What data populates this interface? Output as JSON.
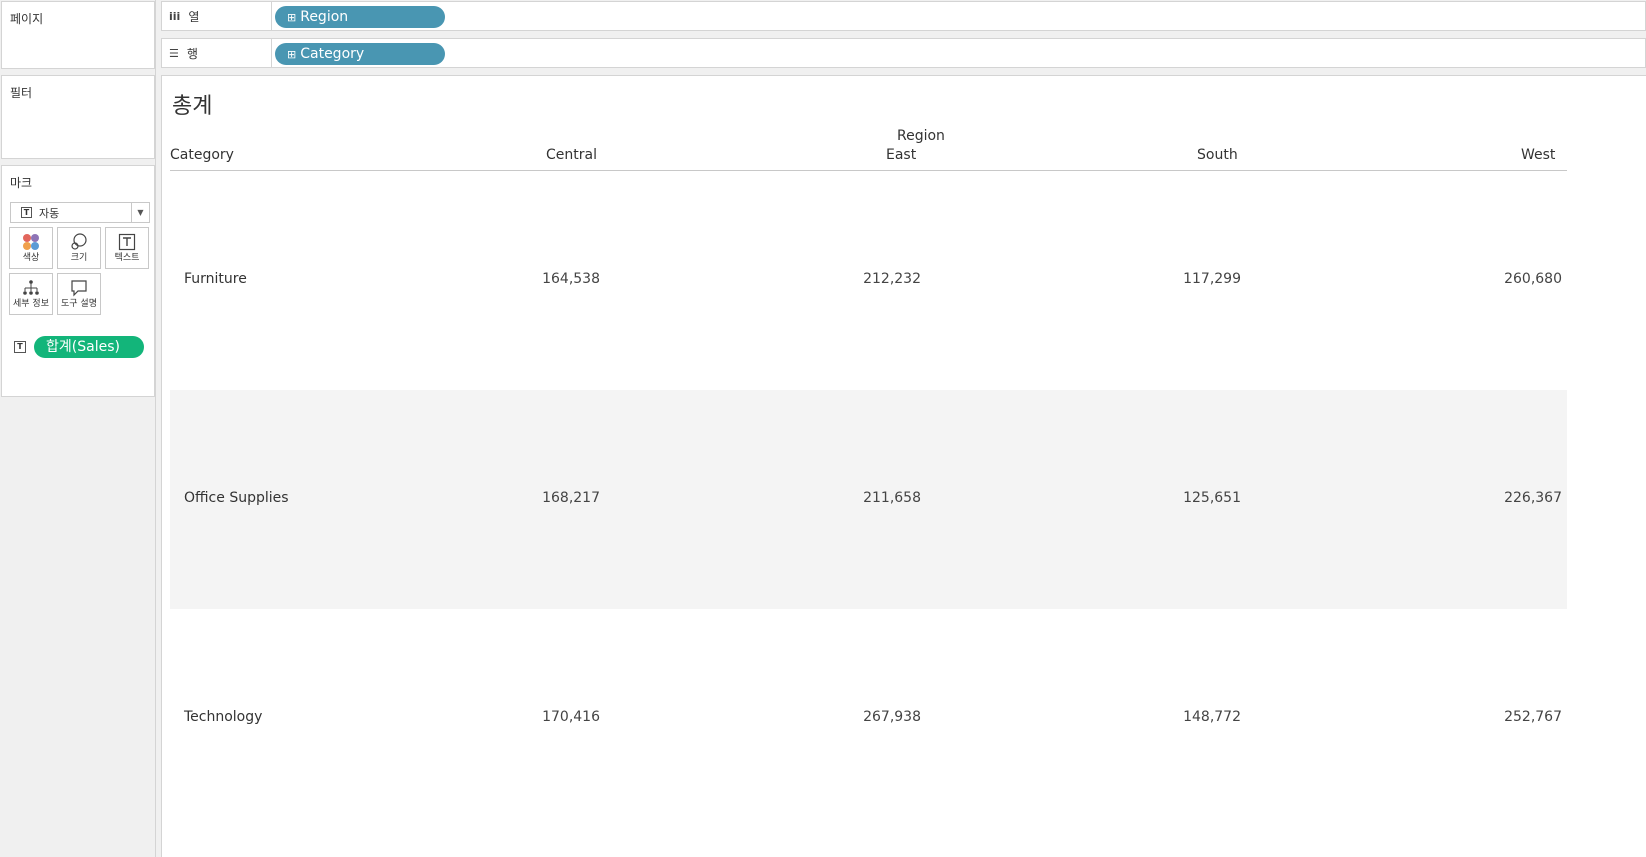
{
  "side": {
    "pages_title": "페이지",
    "filters_title": "필터",
    "marks_title": "마크",
    "mark_type": {
      "icon_glyph": "T",
      "label": "자동",
      "dropdown_glyph": "▼"
    },
    "mark_buttons": {
      "color": "색상",
      "size": "크기",
      "text": "텍스트",
      "detail": "세부 정보",
      "tooltip": "도구 설명"
    },
    "mark_pill": {
      "icon_glyph": "T",
      "label": "합계(Sales)",
      "color": "#13b57a"
    }
  },
  "shelves": {
    "columns": {
      "icon_glyph": "iii",
      "label": "열",
      "pill": "Region",
      "pill_plus": "⊞",
      "pill_color": "#4996b2"
    },
    "rows": {
      "icon_glyph": "☰",
      "label": "행",
      "pill": "Category",
      "pill_plus": "⊞",
      "pill_color": "#4996b2"
    }
  },
  "view": {
    "title": "총계",
    "header": {
      "row_field": "Category",
      "col_field": "Region",
      "columns": [
        "Central",
        "East",
        "South",
        "West"
      ]
    },
    "rows": [
      {
        "category": "Furniture",
        "values": [
          "164,538",
          "212,232",
          "117,299",
          "260,680"
        ]
      },
      {
        "category": "Office Supplies",
        "values": [
          "168,217",
          "211,658",
          "125,651",
          "226,367"
        ]
      },
      {
        "category": "Technology",
        "values": [
          "170,416",
          "267,938",
          "148,772",
          "252,767"
        ]
      }
    ]
  }
}
